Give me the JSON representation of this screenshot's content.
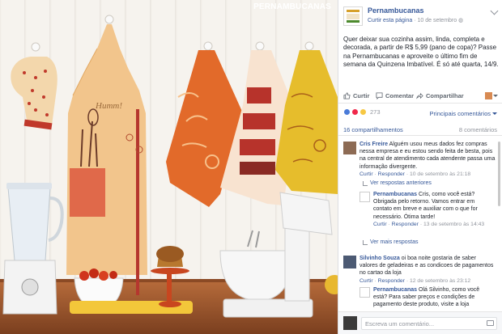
{
  "photo": {
    "watermark": "PERNAMBUCANAS",
    "apron_text": "Humm!",
    "colors": {
      "wall": "#f4f1ec",
      "orange": "#e26a2a",
      "red": "#b7332b",
      "yellow": "#e6bd2c",
      "counter": "#a55a2e"
    }
  },
  "post": {
    "page_name": "Pernambucanas",
    "like_page": "Curtir esta página",
    "date": "10 de setembro",
    "text": "Quer deixar sua cozinha assim, linda, completa e decorada, a partir de R$ 5,99 (pano de copa)? Passe na Pernambucanas e aproveite o último fim de semana da Quinzena Imbatível. É só até quarta, 14/9.",
    "actions": {
      "like": "Curtir",
      "comment": "Comentar",
      "share": "Compartilhar"
    },
    "reactions_count": "273",
    "sort_label": "Principais comentários",
    "shares": "16 compartilhamentos",
    "comment_count": "8 comentários"
  },
  "comments": [
    {
      "author": "Cris Freire",
      "text": "Alguém usou meus dados fez compras nessa empresa e eu estou sendo feita de besta, pois na central de atendimento cada atendente passa uma informação divergente.",
      "like": "Curtir",
      "reply": "Responder",
      "date": "10 de setembro às 21:18"
    },
    {
      "author": "Silvinho Souza",
      "text": "oi boa noite gostaria de saber valores de geladeiras e as condicoes de pagamentos no cartao da loja",
      "like": "Curtir",
      "reply": "Responder",
      "date": "12 de setembro às 23:12"
    }
  ],
  "replies": [
    {
      "author": "Pernambucanas",
      "text": "Cris, como você está? Obrigada pelo retorno. Vamos entrar em contato em breve e auxiliar com o que for necessário. Ótima tarde!",
      "like": "Curtir",
      "reply": "Responder",
      "date": "13 de setembro às 14:43"
    },
    {
      "author": "Pernambucanas",
      "text": "Olá Silvinho, como você está? Para saber preços e condições de pagamento deste produto, visite a loja"
    }
  ],
  "links": {
    "prev_replies": "Ver respostas anteriores",
    "more_replies": "Ver mais respostas"
  },
  "composer": {
    "placeholder": "Escreva um comentário..."
  }
}
